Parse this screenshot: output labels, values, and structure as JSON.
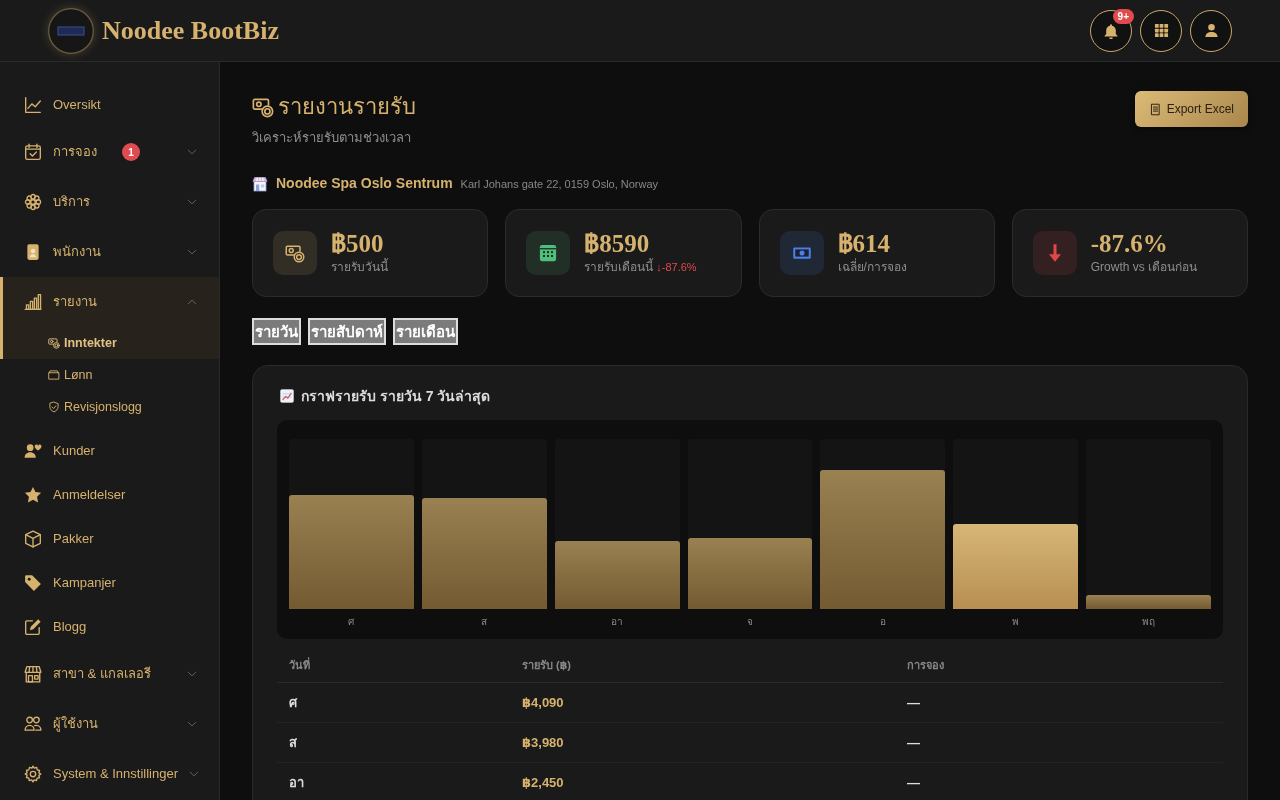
{
  "header": {
    "brand": "Noodee BootBiz",
    "notification_badge": "9+"
  },
  "sidebar": {
    "items": [
      {
        "label": "Oversikt",
        "kind": "link",
        "selected": false
      },
      {
        "label": "การจอง",
        "kind": "group",
        "selected": false,
        "expanded": false,
        "badge": "1"
      },
      {
        "label": "บริการ",
        "kind": "group",
        "selected": false,
        "expanded": false
      },
      {
        "label": "พนักงาน",
        "kind": "group",
        "selected": false,
        "expanded": false
      },
      {
        "label": "รายงาน",
        "kind": "group",
        "selected": true,
        "expanded": true,
        "children": [
          {
            "label": "Inntekter",
            "selected": true
          },
          {
            "label": "Lønn",
            "selected": false
          },
          {
            "label": "Revisjonslogg",
            "selected": false
          }
        ]
      },
      {
        "label": "Kunder",
        "kind": "link",
        "selected": false
      },
      {
        "label": "Anmeldelser",
        "kind": "link",
        "selected": false
      },
      {
        "label": "Pakker",
        "kind": "link",
        "selected": false
      },
      {
        "label": "Kampanjer",
        "kind": "link",
        "selected": false
      },
      {
        "label": "Blogg",
        "kind": "link",
        "selected": false
      },
      {
        "label": "สาขา & แกลเลอรี",
        "kind": "group",
        "selected": false,
        "expanded": false
      },
      {
        "label": "ผู้ใช้งาน",
        "kind": "group",
        "selected": false,
        "expanded": false
      },
      {
        "label": "System & Innstillinger",
        "kind": "group",
        "selected": false,
        "expanded": false
      }
    ]
  },
  "page": {
    "title": "รายงานรายรับ",
    "subtitle": "วิเคราะห์รายรับตามช่วงเวลา",
    "export_button": "Export Excel"
  },
  "branch": {
    "name": "Noodee Spa Oslo Sentrum",
    "address": "Karl Johans gate 22, 0159 Oslo, Norway"
  },
  "stats": [
    {
      "value": "฿500",
      "label": "รายรับวันนี้",
      "color": "#d6b26e"
    },
    {
      "value": "฿8590",
      "label": "รายรับเดือนนี้",
      "change": "↓-87.6%",
      "color": "#4fbf7c"
    },
    {
      "value": "฿614",
      "label": "เฉลี่ย/การจอง",
      "color": "#4a80e8"
    },
    {
      "value": "-87.6%",
      "label": "Growth vs เดือนก่อน",
      "color": "#e04848"
    }
  ],
  "period_tabs": [
    {
      "label": "รายวัน"
    },
    {
      "label": "รายสัปดาห์"
    },
    {
      "label": "รายเดือน"
    }
  ],
  "revenue_chart": {
    "title": "กราฟรายรับ รายวัน 7 วันล่าสุด",
    "bars": [
      {
        "label": "ศ",
        "level": 0.67,
        "highlighted": false
      },
      {
        "label": "ส",
        "level": 0.65,
        "highlighted": false
      },
      {
        "label": "อา",
        "level": 0.4,
        "highlighted": false
      },
      {
        "label": "จ",
        "level": 0.42,
        "highlighted": false
      },
      {
        "label": "อ",
        "level": 0.82,
        "highlighted": false
      },
      {
        "label": "พ",
        "level": 0.5,
        "highlighted": true
      },
      {
        "label": "พฤ",
        "level": 0.08,
        "highlighted": false
      }
    ]
  },
  "revenue_table": {
    "columns": [
      "วันที่",
      "รายรับ (฿)",
      "การจอง"
    ],
    "rows": [
      [
        "ศ",
        "฿4,090",
        "—"
      ],
      [
        "ส",
        "฿3,980",
        "—"
      ],
      [
        "อา",
        "฿2,450",
        "—"
      ]
    ]
  }
}
